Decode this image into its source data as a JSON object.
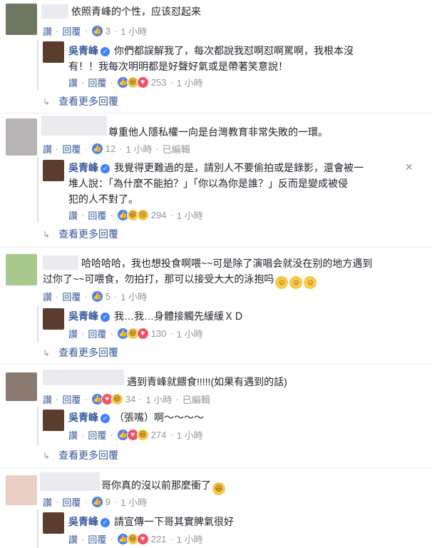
{
  "labels": {
    "like": "讚",
    "reply": "回覆",
    "view_more": "查看更多回覆",
    "edited": "已編輯",
    "close": "✕"
  },
  "colors": {
    "link": "#365899",
    "meta": "#90949c",
    "text": "#1d2129"
  },
  "comments": [
    {
      "avatar_color": "#6f7863",
      "text_lines": [
        "依照青峰的个性，应该怼起来"
      ],
      "reaction_icons": [
        "like-icon"
      ],
      "reaction_count": "3",
      "time": "1 小時",
      "reply": {
        "name": "吳青峰",
        "text_lines": [
          "你們都誤解我了，每次都說我怼啊怼啊罵啊，我根本沒",
          "有！！我每次明明都是好聲好氣或是帶著笑意說！"
        ],
        "reaction_icons": [
          "like-icon",
          "haha-icon",
          "love-icon"
        ],
        "reaction_count": "253",
        "time": "1 小時"
      }
    },
    {
      "avatar_color": "#b9b4b6",
      "text_lines": [
        "尊重他人隱私權一向是台灣教育非常失敗的一環。"
      ],
      "reaction_icons": [
        "like-icon"
      ],
      "reaction_count": "12",
      "time": "1 小時",
      "edited": true,
      "reply": {
        "name": "吳青峰",
        "text_lines": [
          "我覺得更難過的是，請別人不要偷拍或是錄影，還會被一",
          "堆人說：「為什麼不能拍？」「你以為你是誰？」反而是變成被侵",
          "犯的人不對了。"
        ],
        "reaction_icons": [
          "like-icon",
          "haha-icon",
          "sad-icon"
        ],
        "reaction_count": "294",
        "time": "1 小時"
      }
    },
    {
      "avatar_color": "#a7c98e",
      "text_lines": [
        "哈哈哈哈，我也想投食啊喂~~可是除了演唱会就没在别的地方遇到",
        "过你了~~可喂食，勿拍打，那可以接受大大的泳抱吗"
      ],
      "reaction_icons": [
        "like-icon"
      ],
      "reaction_count": "5",
      "time": "1 小時",
      "reply": {
        "name": "吳青峰",
        "text_lines": [
          "我…我…身體接觸先緩緩ＸＤ"
        ],
        "reaction_icons": [
          "like-icon",
          "haha-icon",
          "love-icon"
        ],
        "reaction_count": "130",
        "time": "1 小時"
      }
    },
    {
      "avatar_color": "#8a7a72",
      "text_lines": [
        "遇到青峰就餵食!!!!!(如果有遇到的話)"
      ],
      "reaction_icons": [
        "like-icon",
        "love-icon",
        "haha-icon"
      ],
      "reaction_count": "34",
      "time": "1 小時",
      "edited": true,
      "reply": {
        "name": "吳青峰",
        "text_lines": [
          "（張嘴）啊～～～～"
        ],
        "reaction_icons": [
          "like-icon",
          "love-icon",
          "haha-icon"
        ],
        "reaction_count": "274",
        "time": "1 小時"
      }
    },
    {
      "avatar_color": "#eacfc4",
      "text_lines": [
        "哥你真的沒以前那麼衝了"
      ],
      "reaction_icons": [
        "like-icon"
      ],
      "reaction_count": "9",
      "time": "1 小時",
      "reply": {
        "name": "吳青峰",
        "text_lines": [
          "請宣傳一下哥其實脾氣很好"
        ],
        "reaction_icons": [
          "like-icon",
          "haha-icon",
          "love-icon"
        ],
        "reaction_count": "221",
        "time": "1 小時"
      }
    }
  ]
}
